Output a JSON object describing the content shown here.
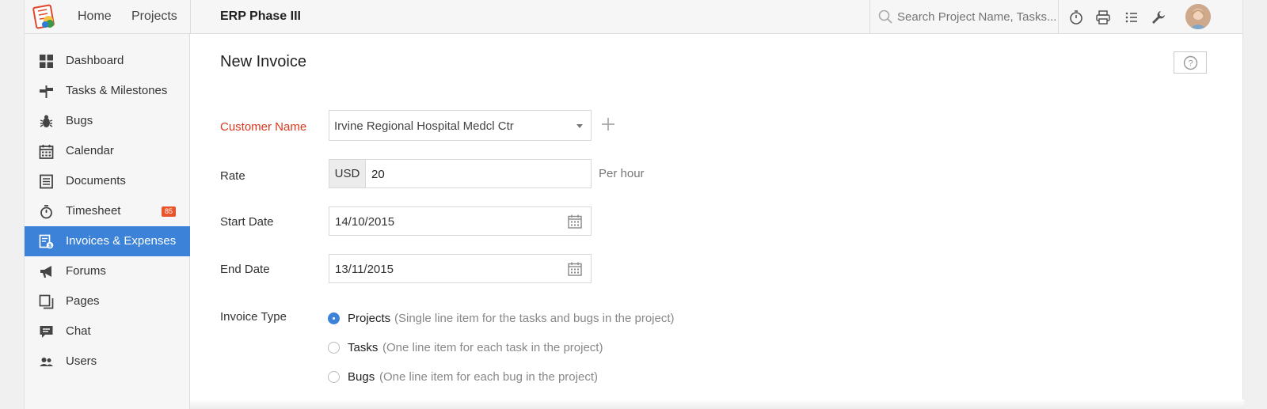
{
  "topbar": {
    "nav": [
      "Home",
      "Projects"
    ],
    "project_title": "ERP Phase III",
    "search_placeholder": "Search Project Name, Tasks..."
  },
  "sidebar": {
    "items": [
      {
        "label": "Dashboard",
        "icon": "dashboard-icon"
      },
      {
        "label": "Tasks & Milestones",
        "icon": "tasks-icon"
      },
      {
        "label": "Bugs",
        "icon": "bug-icon"
      },
      {
        "label": "Calendar",
        "icon": "calendar-icon"
      },
      {
        "label": "Documents",
        "icon": "documents-icon"
      },
      {
        "label": "Timesheet",
        "icon": "timer-icon",
        "badge": "85"
      },
      {
        "label": "Invoices & Expenses",
        "icon": "invoice-icon",
        "active": true
      },
      {
        "label": "Forums",
        "icon": "megaphone-icon"
      },
      {
        "label": "Pages",
        "icon": "pages-icon"
      },
      {
        "label": "Chat",
        "icon": "chat-icon"
      },
      {
        "label": "Users",
        "icon": "users-icon"
      }
    ]
  },
  "form": {
    "title": "New Invoice",
    "customer_label": "Customer Name",
    "customer_value": "Irvine Regional Hospital Medcl Ctr",
    "rate_label": "Rate",
    "currency": "USD",
    "rate_value": "20",
    "rate_unit": "Per hour",
    "start_label": "Start Date",
    "start_value": "14/10/2015",
    "end_label": "End Date",
    "end_value": "13/11/2015",
    "type_label": "Invoice Type",
    "types": [
      {
        "label": "Projects",
        "desc": "(Single line item for the tasks and bugs in the project)",
        "selected": true
      },
      {
        "label": "Tasks",
        "desc": "(One line item for each task in the project)",
        "selected": false
      },
      {
        "label": "Bugs",
        "desc": "(One line item for each bug in the project)",
        "selected": false
      }
    ]
  },
  "colors": {
    "accent": "#3b82d8",
    "required": "#d9391f",
    "badge": "#e8552b"
  }
}
